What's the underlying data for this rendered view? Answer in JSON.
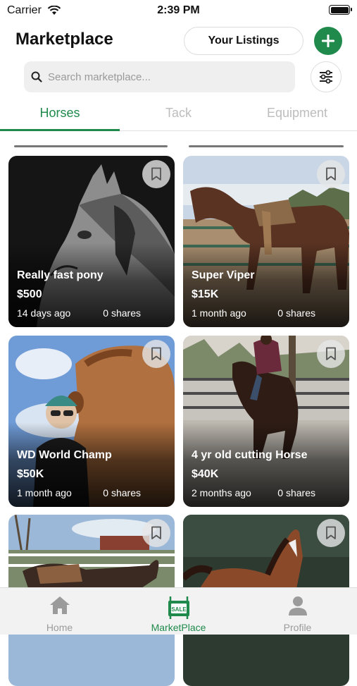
{
  "status_bar": {
    "carrier": "Carrier",
    "time": "2:39 PM"
  },
  "header": {
    "title": "Marketplace",
    "your_listings_label": "Your Listings"
  },
  "search": {
    "placeholder": "Search marketplace..."
  },
  "tabs": [
    {
      "label": "Horses",
      "active": true
    },
    {
      "label": "Tack",
      "active": false
    },
    {
      "label": "Equipment",
      "active": false
    }
  ],
  "listings": [
    {
      "title": "Really fast pony",
      "price": "$500",
      "age": "14 days ago",
      "shares": "0 shares"
    },
    {
      "title": "Super Viper",
      "price": "$15K",
      "age": "1 month ago",
      "shares": "0 shares"
    },
    {
      "title": "WD World Champ",
      "price": "$50K",
      "age": "1 month ago",
      "shares": "0 shares"
    },
    {
      "title": "4 yr old cutting Horse",
      "price": "$40K",
      "age": "2 months ago",
      "shares": "0 shares"
    },
    {
      "title": "",
      "price": "",
      "age": "",
      "shares": ""
    },
    {
      "title": "",
      "price": "",
      "age": "",
      "shares": ""
    }
  ],
  "tab_bar": {
    "items": [
      {
        "label": "Home",
        "icon": "home-icon",
        "active": false
      },
      {
        "label": "MarketPlace",
        "icon": "sale-sign-icon",
        "active": true,
        "badge": "SALE"
      },
      {
        "label": "Profile",
        "icon": "person-icon",
        "active": false
      }
    ]
  },
  "colors": {
    "accent": "#1f8a4c",
    "inactive": "#9b9b9b",
    "tab_inactive": "#bdbdbd"
  }
}
